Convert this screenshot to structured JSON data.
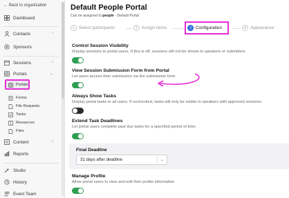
{
  "sidebar": {
    "back_label": "Back to organization",
    "items": {
      "dashboard": "Dashboard",
      "contacts": "Contacts",
      "sponsors": "Sponsors",
      "sessions": "Sessions",
      "portals": "Portals",
      "content": "Content",
      "reports": "Reports",
      "studio": "Studio",
      "history": "History",
      "event_team": "Event Team"
    },
    "portals_sub": {
      "portals": "Portals",
      "forms": "Forms",
      "file_requests": "File Requests",
      "tasks": "Tasks",
      "resources": "Resources",
      "files": "Files"
    }
  },
  "header": {
    "title": "Default People Portal",
    "subtitle_prefix": "Can be assigned to",
    "subtitle_entity": "people",
    "subtitle_suffix": "· Default Portal"
  },
  "steps": [
    {
      "num": "1",
      "label": "Select participants"
    },
    {
      "num": "2",
      "label": "Assign items"
    },
    {
      "num": "3",
      "label": "Configuration"
    },
    {
      "num": "4",
      "label": "Appearance"
    }
  ],
  "settings": {
    "control_visibility": {
      "title": "Control Session Visibility",
      "desc": "Display sessions to portal users. If this is off, sessions will not be shown to speakers or submitters.",
      "enabled": true
    },
    "view_submission": {
      "title": "View Session Submission Form from Portal",
      "desc": "Let users access their submission via the submission form",
      "enabled": true
    },
    "always_show_tasks": {
      "title": "Always Show Tasks",
      "desc": "Display portal tasks to all users. If unchecked, tasks will only be visible to speakers with approved sessions.",
      "enabled": false
    },
    "extend_deadlines": {
      "title": "Extend Task Deadlines",
      "desc": "Let portal users complete past due tasks for a specified period of time.",
      "enabled": true
    },
    "final_deadline": {
      "label": "Final Deadline",
      "value": "31 days after deadline"
    },
    "manage_profile": {
      "title": "Manage Profile",
      "desc": "Allow portal users to view and edit their profile information",
      "enabled": true
    }
  },
  "colors": {
    "accent": "#2d6cdf",
    "toggle_on": "#2f9e53",
    "highlight": "#e62cd6"
  }
}
